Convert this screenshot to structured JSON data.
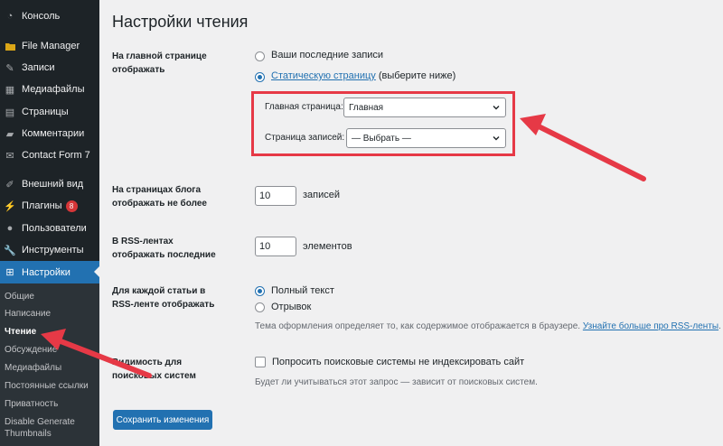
{
  "sidebar": {
    "items": [
      {
        "label": "Консоль",
        "icon": "dashboard-icon"
      },
      {
        "label": "File Manager",
        "icon": "folder-icon"
      },
      {
        "label": "Записи",
        "icon": "pin-icon"
      },
      {
        "label": "Медиафайлы",
        "icon": "media-icon"
      },
      {
        "label": "Страницы",
        "icon": "page-icon"
      },
      {
        "label": "Комментарии",
        "icon": "comment-icon"
      },
      {
        "label": "Contact Form 7",
        "icon": "mail-icon"
      },
      {
        "label": "Внешний вид",
        "icon": "brush-icon"
      },
      {
        "label": "Плагины",
        "icon": "plugin-icon",
        "badge": "8"
      },
      {
        "label": "Пользователи",
        "icon": "user-icon"
      },
      {
        "label": "Инструменты",
        "icon": "wrench-icon"
      },
      {
        "label": "Настройки",
        "icon": "settings-icon"
      }
    ],
    "submenu": [
      "Общие",
      "Написание",
      "Чтение",
      "Обсуждение",
      "Медиафайлы",
      "Постоянные ссылки",
      "Приватность",
      "Disable Generate Thumbnails"
    ]
  },
  "page": {
    "title": "Настройки чтения",
    "front_page": {
      "label": "На главной странице отображать",
      "option_latest": "Ваши последние записи",
      "option_static_link": "Статическую страницу",
      "option_static_suffix": " (выберите ниже)",
      "homepage_label": "Главная страница:",
      "homepage_value": "Главная",
      "posts_page_label": "Страница записей:",
      "posts_page_value": "— Выбрать —"
    },
    "posts_per_page": {
      "label": "На страницах блога отображать не более",
      "value": "10",
      "unit": "записей"
    },
    "rss_items": {
      "label": "В RSS-лентах отображать последние",
      "value": "10",
      "unit": "элементов"
    },
    "rss_content": {
      "label": "Для каждой статьи в RSS-ленте отображать",
      "option_full": "Полный текст",
      "option_excerpt": "Отрывок",
      "description": "Тема оформления определяет то, как содержимое отображается в браузере. ",
      "description_link": "Узнайте больше про RSS-ленты",
      "description_end": "."
    },
    "search_visibility": {
      "label": "Видимость для поисковых систем",
      "checkbox_label": "Попросить поисковые системы не индексировать сайт",
      "description": "Будет ли учитываться этот запрос — зависит от поисковых систем."
    },
    "save_button": "Сохранить изменения"
  },
  "colors": {
    "sidebar_bg": "#1d2327",
    "submenu_bg": "#2c3338",
    "accent": "#2271b1",
    "annotation": "#e63946",
    "badge": "#d63638"
  }
}
